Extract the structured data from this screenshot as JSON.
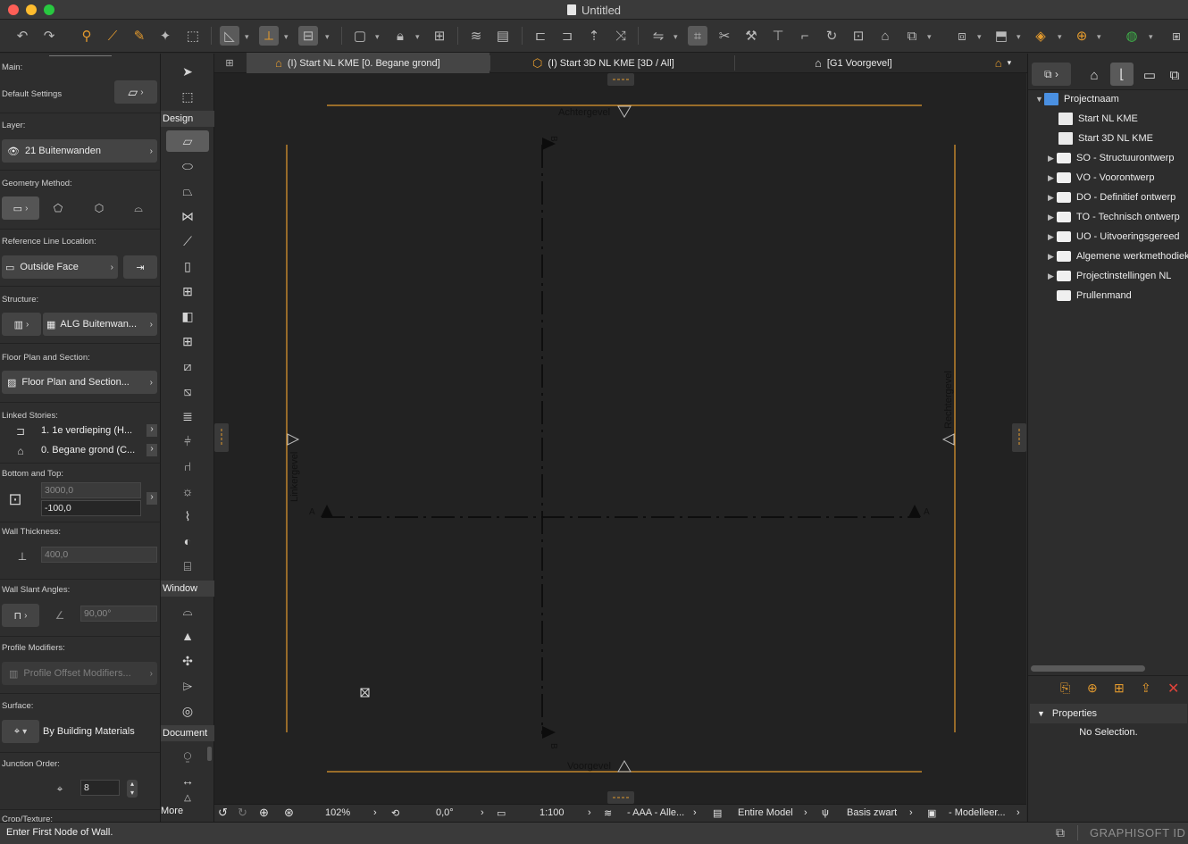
{
  "window": {
    "title": "Untitled"
  },
  "toolbar": {
    "icons": [
      "undo-icon",
      "redo-icon",
      "pick-up-icon",
      "eyedropper-icon",
      "inject-icon",
      "magic-wand-icon",
      "trace-icon",
      "arrow-select-icon",
      "guide-line-icon",
      "snap-icon",
      "layer-icon",
      "lock-icon",
      "dimension-icon",
      "story-icon",
      "material-icon"
    ]
  },
  "infobox": {
    "main_label": "Main:",
    "default_settings": "Default Settings",
    "layer_label": "Layer:",
    "layer_value": "21 Buitenwanden",
    "geometry_label": "Geometry Method:",
    "refline_label": "Reference Line Location:",
    "refline_value": "Outside Face",
    "structure_label": "Structure:",
    "structure_value": "ALG Buitenwan...",
    "floorplan_label": "Floor Plan and Section:",
    "floorplan_value": "Floor Plan and Section...",
    "linked_label": "Linked Stories:",
    "linked_top": "1. 1e verdieping (H...",
    "linked_bottom": "0. Begane grond (C...",
    "bottomtop_label": "Bottom and Top:",
    "height_value": "3000,0",
    "offset_value": "-100,0",
    "thickness_label": "Wall Thickness:",
    "thickness_value": "400,0",
    "slant_label": "Wall Slant Angles:",
    "slant_value": "90,00°",
    "profile_label": "Profile Modifiers:",
    "profile_value": "Profile Offset Modifiers...",
    "surface_label": "Surface:",
    "surface_value": "By Building Materials",
    "junction_label": "Junction Order:",
    "junction_value": "8",
    "crop_label": "Crop/Texture:"
  },
  "toolbox": {
    "design_label": "Design",
    "window_label": "Window",
    "document_label": "Document",
    "more_label": "More"
  },
  "tabs": [
    {
      "label": "(I) Start NL KME [0. Begane grond]"
    },
    {
      "label": "(I) Start 3D NL KME [3D / All]"
    },
    {
      "label": "[G1 Voorgevel]"
    }
  ],
  "canvas": {
    "achtergevel": "Achtergevel",
    "voorgevel": "Voorgevel",
    "linkergevel": "Linkergevel",
    "rechtergevel": "Rechtergevel",
    "marker_a": "A",
    "marker_b": "B"
  },
  "bottombar": {
    "zoom": "102%",
    "angle": "0,0°",
    "scale": "1:100",
    "layers": "- AAA - Alle...",
    "model": "Entire Model",
    "pen": "Basis zwart",
    "mvo": "- Modelleer..."
  },
  "navigator": {
    "root": "Projectnaam",
    "items": [
      "Start NL KME",
      "Start 3D NL KME",
      "SO - Structuurontwerp",
      "VO - Voorontwerp",
      "DO - Definitief ontwerp",
      "TO - Technisch ontwerp",
      "UO - Uitvoeringsgereed",
      "Algemene werkmethodiek",
      "Projectinstellingen NL",
      "Prullenmand"
    ],
    "properties_label": "Properties",
    "no_selection": "No Selection."
  },
  "status": {
    "prompt": "Enter First Node of Wall.",
    "brand": "GRAPHISOFT ID"
  },
  "colors": {
    "accent": "#e39a2e",
    "canvas": "#222222"
  }
}
